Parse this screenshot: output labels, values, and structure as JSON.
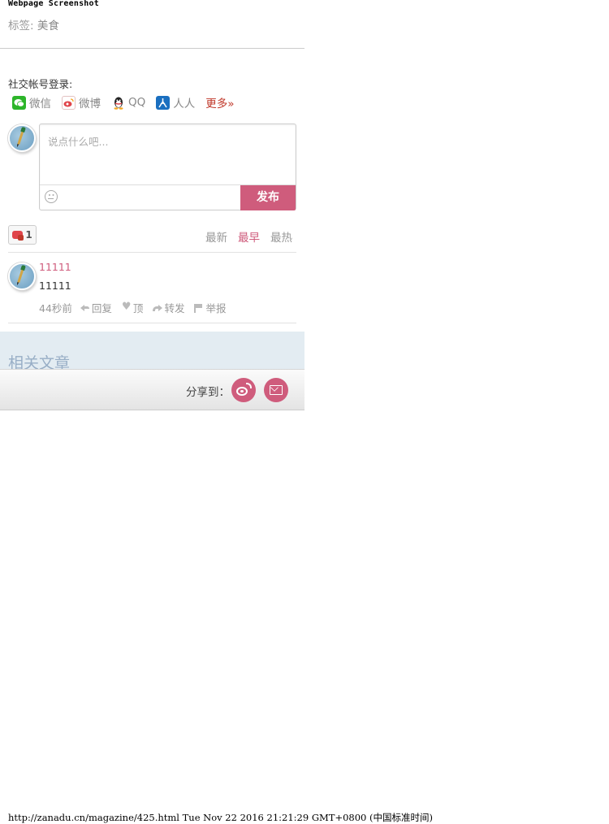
{
  "header": {
    "screenshot_label": "Webpage Screenshot",
    "tags_prefix": "标签:",
    "tag": "美食"
  },
  "social_login": {
    "title": "社交帐号登录:",
    "items": [
      {
        "label": "微信",
        "icon": "wechat-icon",
        "color": "#2db52a"
      },
      {
        "label": "微博",
        "icon": "weibo-icon",
        "color": "#e0444a"
      },
      {
        "label": "QQ",
        "icon": "qq-icon",
        "color": "#222222"
      },
      {
        "label": "人人",
        "icon": "renren-icon",
        "color": "#1a6fc0"
      }
    ],
    "more": "更多»"
  },
  "comment_form": {
    "placeholder": "说点什么吧...",
    "publish_label": "发布"
  },
  "toolbar": {
    "like_count": "1",
    "sort_tabs": [
      "最新",
      "最早",
      "最热"
    ],
    "active_sort": "最早"
  },
  "comments": [
    {
      "author": "11111",
      "text": "11111",
      "time": "44秒前",
      "reply": "回复",
      "upvote": "顶",
      "forward": "转发",
      "report": "举报"
    }
  ],
  "related": {
    "title": "相关文章"
  },
  "share": {
    "label": "分享到：",
    "buttons": [
      "weibo-share-icon",
      "mail-share-icon"
    ]
  },
  "footer": {
    "capture_info": "http://zanadu.cn/magazine/425.html Tue Nov 22 2016 21:21:29 GMT+0800 (中国标准时间)"
  },
  "colors": {
    "accent": "#cf5c7c",
    "related_bg": "#e3ecf2"
  }
}
